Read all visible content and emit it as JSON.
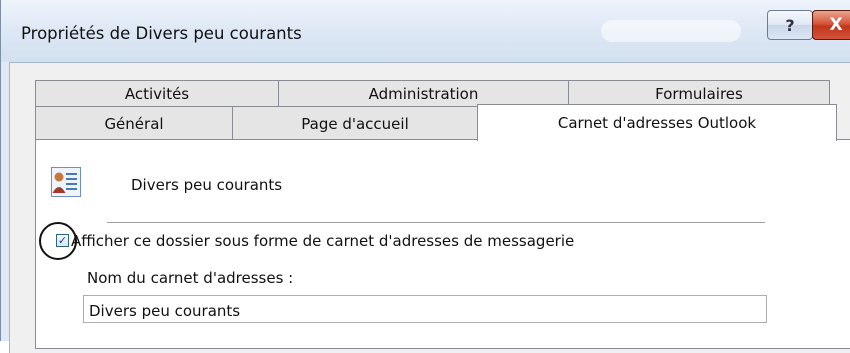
{
  "window": {
    "title": "Propriétés de Divers peu courants",
    "help_glyph": "?",
    "close_glyph": "X"
  },
  "tabs": {
    "row1": [
      "Activités",
      "Administration",
      "Formulaires"
    ],
    "row2": [
      "Général",
      "Page d'accueil",
      "Carnet d'adresses Outlook"
    ],
    "active": "Carnet d'adresses Outlook"
  },
  "panel": {
    "folder_icon": "contact-card-icon",
    "folder_name": "Divers peu courants",
    "checkbox_label": "Afficher ce dossier sous forme de carnet d'adresses de messagerie",
    "checkbox_checked": true,
    "field_label": "Nom du carnet d'adresses :",
    "field_value": "Divers peu courants"
  },
  "colors": {
    "titlebar": "#dce7f4",
    "close_button": "#c2361b",
    "annotation_circle": "#111111"
  }
}
